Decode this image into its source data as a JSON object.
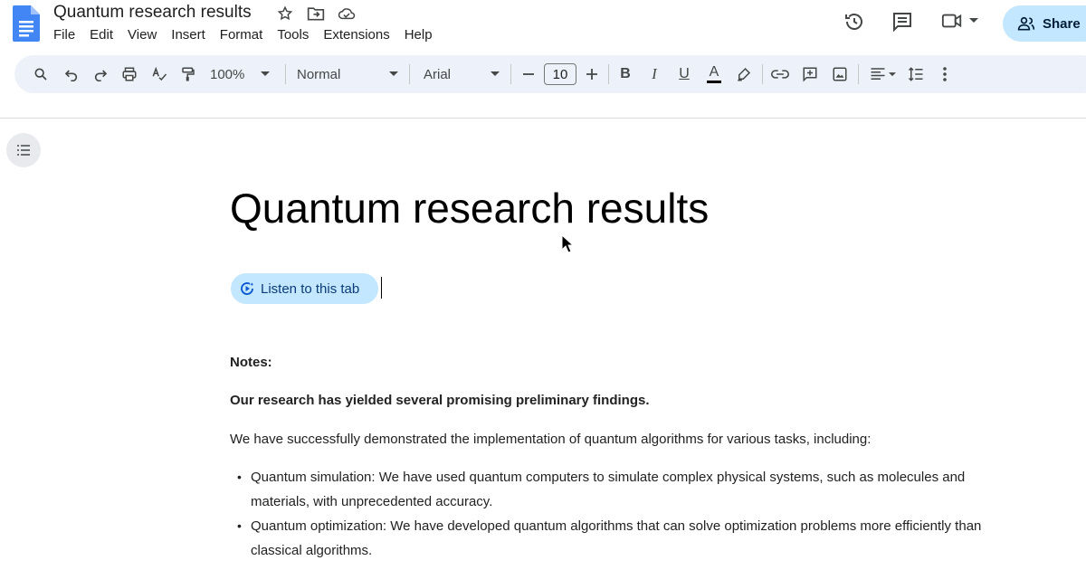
{
  "document": {
    "title": "Quantum research results"
  },
  "menu": [
    "File",
    "Edit",
    "View",
    "Insert",
    "Format",
    "Tools",
    "Extensions",
    "Help"
  ],
  "header": {
    "share_label": "Share"
  },
  "toolbar": {
    "zoom": "100%",
    "style": "Normal",
    "font": "Arial",
    "font_size": "10",
    "bold_label": "B",
    "italic_label": "I",
    "underline_label": "U",
    "text_color_label": "A"
  },
  "content": {
    "heading": "Quantum research results",
    "listen_label": "Listen to this tab",
    "notes_label": "Notes:",
    "intro_bold": "Our research has yielded several promising preliminary findings.",
    "paragraph": "We have successfully demonstrated the implementation of quantum algorithms for various tasks, including:",
    "bullets": [
      {
        "line1": "Quantum simulation: We have used quantum computers to simulate complex physical systems, such as molecules and",
        "line2": "materials, with unprecedented accuracy."
      },
      {
        "line1": "Quantum optimization: We have developed quantum algorithms that can solve optimization problems more efficiently than",
        "line2": "classical algorithms."
      }
    ]
  },
  "colors": {
    "accent": "#c2e7ff",
    "toolbar_bg": "#edf2fa",
    "docs_blue": "#4285f4"
  },
  "icons": [
    "docs-logo-icon",
    "star-icon",
    "move-folder-icon",
    "cloud-icon",
    "history-icon",
    "comment-icon",
    "video-call-icon",
    "people-icon",
    "search-icon",
    "undo-icon",
    "redo-icon",
    "print-icon",
    "spellcheck-icon",
    "paint-format-icon",
    "link-icon",
    "add-comment-icon",
    "image-icon",
    "align-icon",
    "line-spacing-icon",
    "more-icon",
    "outline-icon",
    "listen-icon"
  ]
}
